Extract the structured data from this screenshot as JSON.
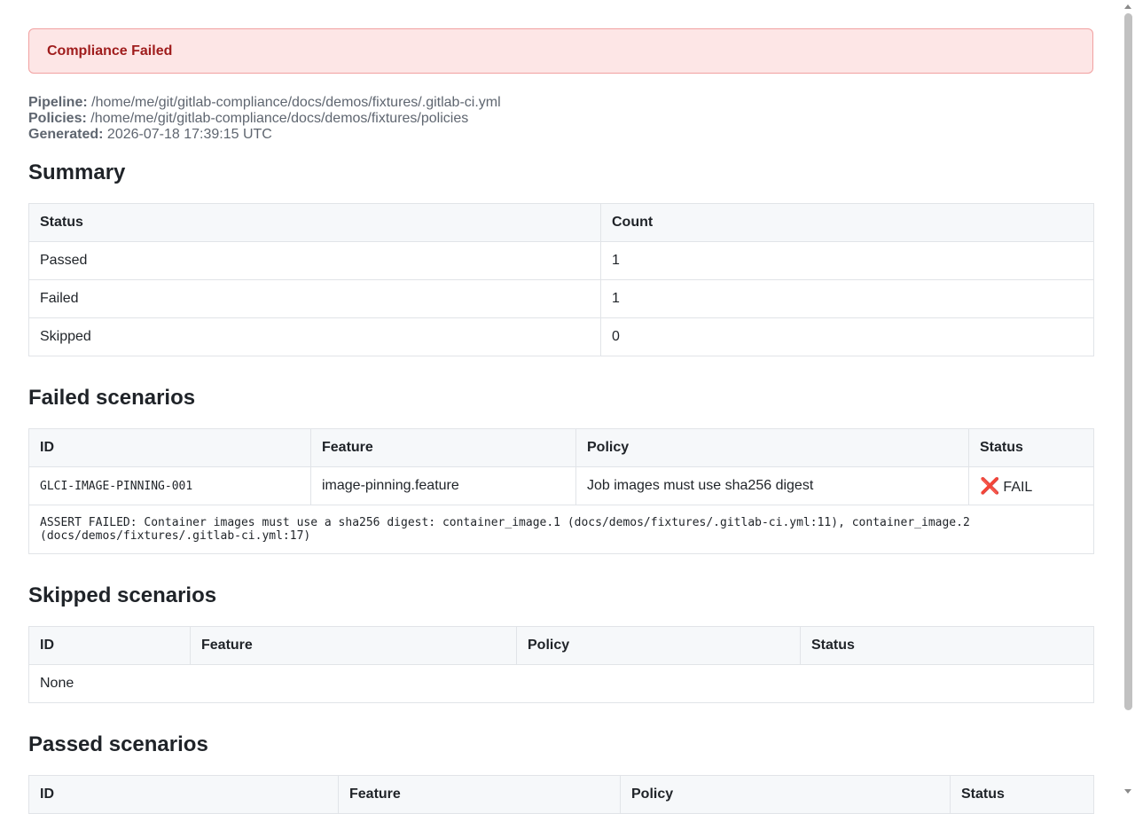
{
  "banner": {
    "text": "Compliance Failed"
  },
  "meta": {
    "pipeline_label": "Pipeline:",
    "pipeline_value": "/home/me/git/gitlab-compliance/docs/demos/fixtures/.gitlab-ci.yml",
    "policies_label": "Policies:",
    "policies_value": "/home/me/git/gitlab-compliance/docs/demos/fixtures/policies",
    "generated_label": "Generated:",
    "generated_value": "2026-07-18 17:39:15 UTC"
  },
  "summary": {
    "heading": "Summary",
    "headers": [
      "Status",
      "Count"
    ],
    "rows": [
      [
        "Passed",
        "1"
      ],
      [
        "Failed",
        "1"
      ],
      [
        "Skipped",
        "0"
      ]
    ]
  },
  "failed": {
    "heading": "Failed scenarios",
    "headers": [
      "ID",
      "Feature",
      "Policy",
      "Status"
    ],
    "rows": [
      {
        "id": "GLCI-IMAGE-PINNING-001",
        "feature": "image-pinning.feature",
        "policy": "Job images must use sha256 digest",
        "status_icon": "❌",
        "status": "FAIL",
        "detail": "ASSERT FAILED: Container images must use a sha256 digest: container_image.1 (docs/demos/fixtures/.gitlab-ci.yml:11), container_image.2 (docs/demos/fixtures/.gitlab-ci.yml:17)"
      }
    ]
  },
  "skipped": {
    "heading": "Skipped scenarios",
    "headers": [
      "ID",
      "Feature",
      "Policy",
      "Status"
    ],
    "empty": "None"
  },
  "passed": {
    "heading": "Passed scenarios",
    "headers": [
      "ID",
      "Feature",
      "Policy",
      "Status"
    ]
  },
  "colors": {
    "banner_bg": "#fde6e6",
    "banner_text": "#9f1c1c",
    "fail_icon": "#e0301e"
  }
}
